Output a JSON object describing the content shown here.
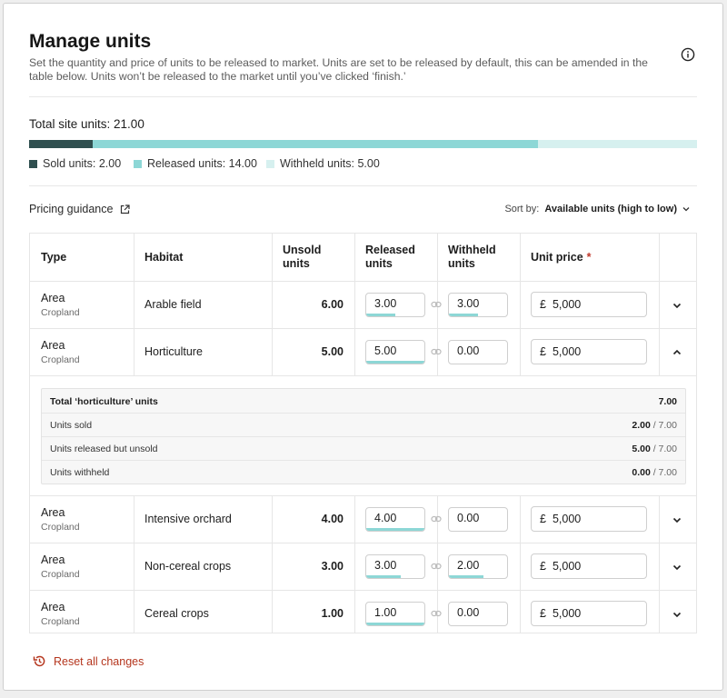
{
  "header": {
    "title": "Manage units",
    "description": "Set the quantity and price of units to be released to market. Units are set to be released by default, this can be amended in the table below. Units won’t be released to the market until you’ve clicked ‘finish.’",
    "info_icon": "info-icon"
  },
  "summary": {
    "total_label": "Total site units: 21.00",
    "total": 21.0,
    "sold": 2.0,
    "released": 14.0,
    "withheld": 5.0,
    "legend": {
      "sold": "Sold units: 2.00",
      "released": "Released units: 14.00",
      "withheld": "Withheld units: 5.00"
    },
    "colors": {
      "sold": "#2f4f4f",
      "released": "#8dd7d6",
      "withheld": "#d6f0ef"
    }
  },
  "toolbar": {
    "pricing_guidance": "Pricing guidance",
    "sort_label": "Sort by:",
    "sort_value": "Available units (high to low)"
  },
  "table": {
    "headers": {
      "type": "Type",
      "habitat": "Habitat",
      "unsold_l1": "Unsold",
      "unsold_l2": "units",
      "released_l1": "Released",
      "released_l2": "units",
      "withheld_l1": "Withheld",
      "withheld_l2": "units",
      "price": "Unit price",
      "required": "*"
    },
    "rows": [
      {
        "type": "Area",
        "subtype": "Cropland",
        "habitat": "Arable field",
        "unsold": "6.00",
        "released": "3.00",
        "withheld": "3.00",
        "released_fill": 0.5,
        "withheld_fill": 0.5,
        "currency": "£",
        "price": "5,000",
        "expanded": false
      },
      {
        "type": "Area",
        "subtype": "Cropland",
        "habitat": "Horticulture",
        "unsold": "5.00",
        "released": "5.00",
        "withheld": "0.00",
        "released_fill": 1.0,
        "withheld_fill": 0.0,
        "currency": "£",
        "price": "5,000",
        "expanded": true
      },
      {
        "type": "Area",
        "subtype": "Cropland",
        "habitat": "Intensive orchard",
        "unsold": "4.00",
        "released": "4.00",
        "withheld": "0.00",
        "released_fill": 1.0,
        "withheld_fill": 0.0,
        "currency": "£",
        "price": "5,000",
        "expanded": false
      },
      {
        "type": "Area",
        "subtype": "Cropland",
        "habitat": "Non-cereal crops",
        "unsold": "3.00",
        "released": "3.00",
        "withheld": "2.00",
        "released_fill": 0.6,
        "withheld_fill": 0.6,
        "currency": "£",
        "price": "5,000",
        "expanded": false
      },
      {
        "type": "Area",
        "subtype": "Cropland",
        "habitat": "Cereal crops",
        "unsold": "1.00",
        "released": "1.00",
        "withheld": "0.00",
        "released_fill": 1.0,
        "withheld_fill": 0.0,
        "currency": "£",
        "price": "5,000",
        "expanded": false
      }
    ],
    "details": {
      "title": "Total ‘horticulture’ units",
      "total": "7.00",
      "items": [
        {
          "label": "Units sold",
          "value": "2.00",
          "of": "/ 7.00"
        },
        {
          "label": "Units released but unsold",
          "value": "5.00",
          "of": "/ 7.00"
        },
        {
          "label": "Units withheld",
          "value": "0.00",
          "of": "/ 7.00"
        }
      ]
    }
  },
  "footer": {
    "reset": "Reset all changes"
  }
}
